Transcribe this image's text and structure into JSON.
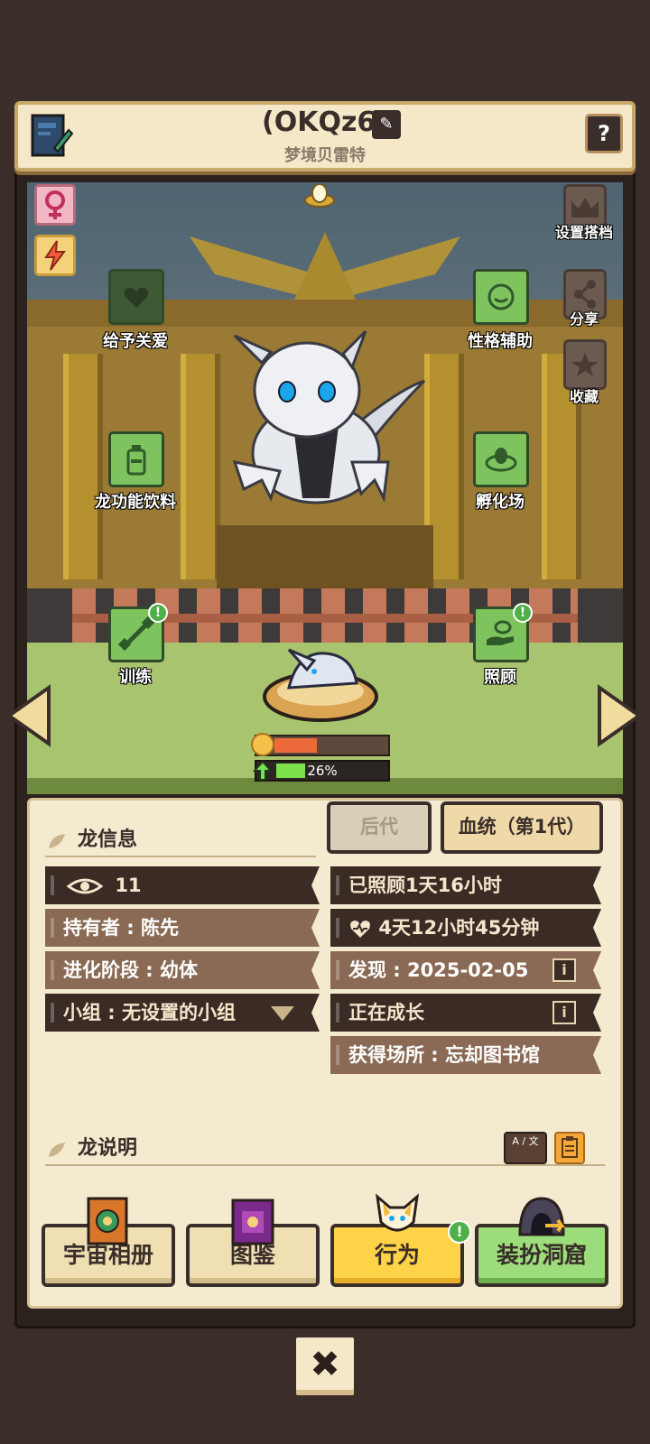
{
  "header": {
    "title": "(OKQz6)",
    "subtitle": "梦境贝雷特",
    "help_label": "?"
  },
  "scene": {
    "side_buttons": [
      {
        "label": "设置搭档",
        "icon": "crown-icon"
      },
      {
        "label": "分享",
        "icon": "share-icon"
      },
      {
        "label": "收藏",
        "icon": "star-icon"
      }
    ],
    "actions": {
      "love": "给予关爱",
      "personality": "性格辅助",
      "drink": "龙功能饮料",
      "incubator": "孵化场",
      "train": "训练",
      "care": "照顾"
    },
    "alert_glyph": "!",
    "growth_percent_text": "26%",
    "mood_level": 0.38,
    "growth_level": 0.26
  },
  "tabs": {
    "offspring": "后代",
    "lineage": "血统（第1代）"
  },
  "info": {
    "title": "龙信息",
    "views": "11",
    "owner": "持有者 : 陈先",
    "stage": "进化阶段 : 幼体",
    "group": "小组 : 无设置的小组",
    "cared": "已照顾1天16小时",
    "time_left": "4天12小时45分钟",
    "discovered": "发现 : 2025-02-05",
    "status": "正在成长",
    "obtained": "获得场所 : 忘却图书馆",
    "info_glyph": "i"
  },
  "description": {
    "title": "龙说明",
    "translate_label": "A / 文"
  },
  "bottom_nav": {
    "album": "宇宙相册",
    "codex": "图鉴",
    "behavior": "行为",
    "dress": "装扮洞窟"
  },
  "close_glyph": "✖",
  "colors": {
    "panel_bg": "#f4ead0",
    "row_dark": "#3a2b24",
    "row_light": "#8a6a55",
    "accent_yellow": "#ffd348",
    "accent_green": "#9ddc7a"
  }
}
